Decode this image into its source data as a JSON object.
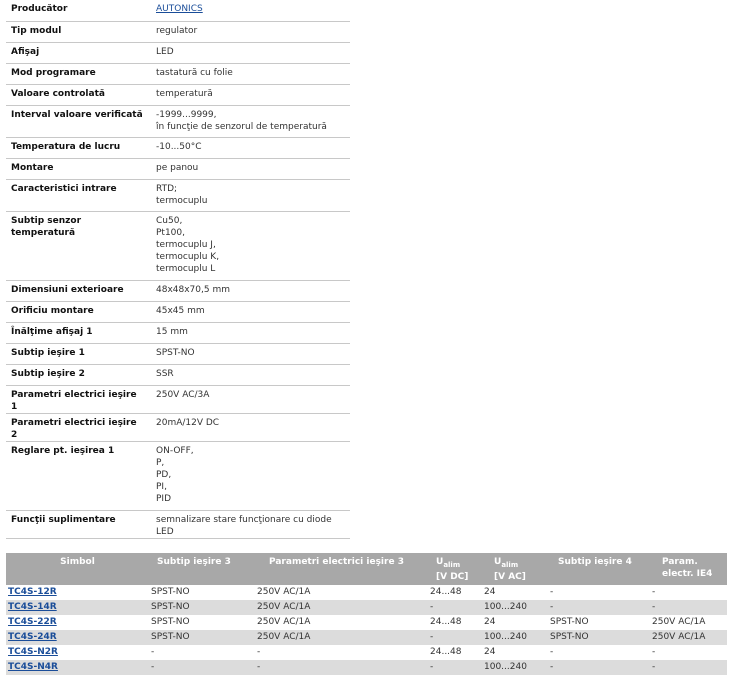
{
  "spec": [
    {
      "label": "Producător",
      "value": [
        "AUTONICS"
      ],
      "link": true
    },
    {
      "label": "Tip modul",
      "value": [
        "regulator"
      ]
    },
    {
      "label": "Afişaj",
      "value": [
        "LED"
      ]
    },
    {
      "label": "Mod programare",
      "value": [
        "tastatură cu folie"
      ]
    },
    {
      "label": "Valoare controlată",
      "value": [
        "temperatură"
      ]
    },
    {
      "label": "Interval valoare verificată",
      "value": [
        "-1999...9999,",
        "în funcţie de senzorul de temperatură"
      ]
    },
    {
      "label": "Temperatura de lucru",
      "value": [
        "-10...50°C"
      ]
    },
    {
      "label": "Montare",
      "value": [
        "pe panou"
      ]
    },
    {
      "label": "Caracteristici intrare",
      "value": [
        "RTD;",
        "termocuplu"
      ]
    },
    {
      "label": "Subtip senzor temperatură",
      "value": [
        "Cu50,",
        "Pt100,",
        "termocuplu J,",
        "termocuplu K,",
        "termocuplu L"
      ]
    },
    {
      "label": "Dimensiuni exterioare",
      "value": [
        "48x48x70,5 mm"
      ]
    },
    {
      "label": "Orificiu montare",
      "value": [
        "45x45 mm"
      ]
    },
    {
      "label": "Înălţime afişaj 1",
      "value": [
        "15 mm"
      ]
    },
    {
      "label": "Subtip ieşire 1",
      "value": [
        "SPST-NO"
      ]
    },
    {
      "label": "Subtip ieşire 2",
      "value": [
        "SSR"
      ]
    },
    {
      "label": "Parametri electrici ieşire 1",
      "value": [
        "250V AC/3A"
      ]
    },
    {
      "label": "Parametri electrici ieşire 2",
      "value": [
        "20mA/12V DC"
      ]
    },
    {
      "label": "Reglare pt. ieşirea 1",
      "value": [
        "ON-OFF,",
        "P,",
        "PD,",
        "PI,",
        "PID"
      ]
    },
    {
      "label": "Funcţii suplimentare",
      "value": [
        "semnalizare stare funcţionare cu diode LED"
      ]
    }
  ],
  "models": {
    "headers": {
      "simbol": "Simbol",
      "out3": "Subtip ieşire 3",
      "par3": "Parametri electrici ieşire 3",
      "u1_main": "U",
      "u1_sub": "alim",
      "u1_unit": "[V DC]",
      "u2_main": "U",
      "u2_sub": "alim",
      "u2_unit": "[V AC]",
      "out4": "Subtip ieşire 4",
      "par4": "Param. electr. IE4"
    },
    "rows": [
      [
        "TC4S-12R",
        "SPST-NO",
        "250V AC/1A",
        "24...48",
        "24",
        "-",
        "-"
      ],
      [
        "TC4S-14R",
        "SPST-NO",
        "250V AC/1A",
        "-",
        "100...240",
        "-",
        "-"
      ],
      [
        "TC4S-22R",
        "SPST-NO",
        "250V AC/1A",
        "24...48",
        "24",
        "SPST-NO",
        "250V AC/1A"
      ],
      [
        "TC4S-24R",
        "SPST-NO",
        "250V AC/1A",
        "-",
        "100...240",
        "SPST-NO",
        "250V AC/1A"
      ],
      [
        "TC4S-N2R",
        "-",
        "-",
        "24...48",
        "24",
        "-",
        "-"
      ],
      [
        "TC4S-N4R",
        "-",
        "-",
        "-",
        "100...240",
        "-",
        "-"
      ]
    ]
  }
}
